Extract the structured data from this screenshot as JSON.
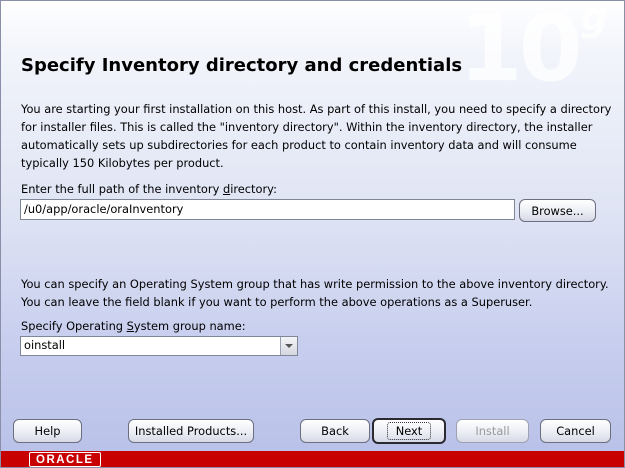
{
  "watermark": {
    "number": "10",
    "letter": "g"
  },
  "page": {
    "title": "Specify Inventory directory and credentials",
    "intro": "You are starting your first installation on this host. As part of this install, you need to specify a directory for installer files. This is called the \"inventory directory\". Within the inventory directory, the installer automatically sets up subdirectories for each product to contain inventory data and will consume typically 150 Kilobytes per product.",
    "path_label_pre": "Enter the full path of the inventory ",
    "path_label_mnemonic": "d",
    "path_label_post": "irectory:",
    "path_value": "/u0/app/oracle/oraInventory",
    "browse_label": "Browse...",
    "group_text": "You can specify an Operating System group that has write permission to the above inventory directory. You can leave the field blank if you want to perform the above operations as a Superuser.",
    "group_label_pre": "Specify Operating ",
    "group_label_mnemonic": "S",
    "group_label_post": "ystem group name:",
    "group_value": "oinstall"
  },
  "buttons": {
    "help": "Help",
    "installed_products": "Installed Products...",
    "back": "Back",
    "next": "Next",
    "install": "Install",
    "cancel": "Cancel"
  },
  "footer": {
    "logo": "ORACLE"
  },
  "colors": {
    "footer": "#c80000",
    "accent": "#c6cdee"
  }
}
